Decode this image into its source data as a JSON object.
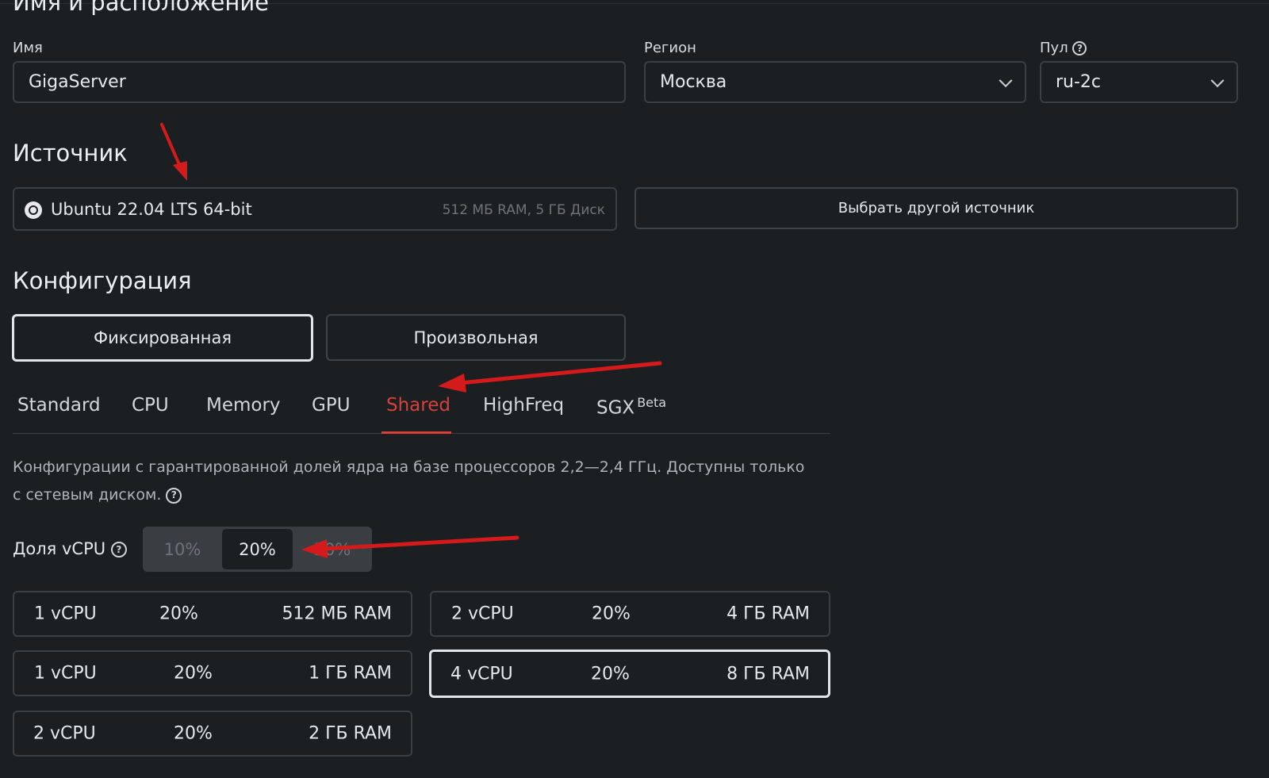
{
  "header": {
    "title": "Имя и расположение"
  },
  "name_field": {
    "label": "Имя",
    "value": "GigaServer"
  },
  "region_field": {
    "label": "Регион",
    "value": "Москва"
  },
  "pool_field": {
    "label": "Пул",
    "value": "ru-2c"
  },
  "source": {
    "title": "Источник",
    "image_name": "Ubuntu 22.04 LTS 64-bit",
    "image_specs": "512 МБ RAM, 5 ГБ Диск",
    "choose_other_label": "Выбрать другой источник"
  },
  "configuration": {
    "title": "Конфигурация",
    "mode_fixed_label": "Фиксированная",
    "mode_custom_label": "Произвольная",
    "tabs": [
      {
        "label": "Standard"
      },
      {
        "label": "CPU"
      },
      {
        "label": "Memory"
      },
      {
        "label": "GPU"
      },
      {
        "label": "Shared"
      },
      {
        "label": "HighFreq"
      },
      {
        "label": "SGX",
        "badge": "Beta"
      }
    ],
    "active_tab": "Shared",
    "description_line1": "Конфигурации с гарантированной долей ядра на базе процессоров 2,2—2,4 ГГц. Доступны только",
    "description_line2": "с сетевым диском.",
    "vcpu_share": {
      "label": "Доля vCPU",
      "options": [
        "10%",
        "20%",
        "50%"
      ],
      "selected": "20%"
    },
    "presets": [
      {
        "vcpu": "1 vCPU",
        "share": "20%",
        "ram": "512 МБ RAM"
      },
      {
        "vcpu": "2 vCPU",
        "share": "20%",
        "ram": "4 ГБ RAM"
      },
      {
        "vcpu": "1 vCPU",
        "share": "20%",
        "ram": "1 ГБ RAM"
      },
      {
        "vcpu": "4 vCPU",
        "share": "20%",
        "ram": "8 ГБ RAM",
        "selected": true
      },
      {
        "vcpu": "2 vCPU",
        "share": "20%",
        "ram": "2 ГБ RAM"
      }
    ]
  },
  "colors": {
    "background": "#1c1f22",
    "accent_red": "#d8403c",
    "annotation_arrow": "#d41a1a"
  }
}
